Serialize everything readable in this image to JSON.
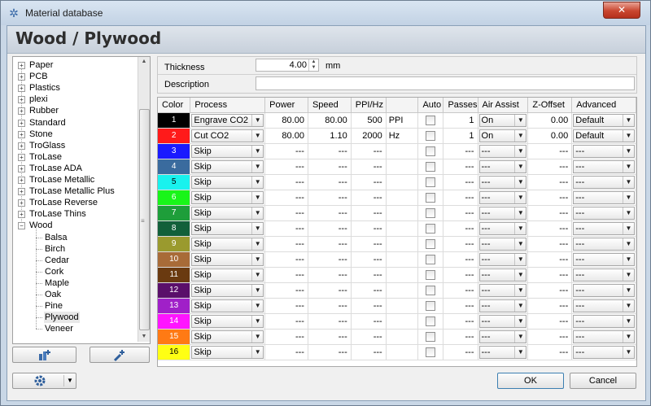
{
  "window": {
    "title": "Material database",
    "close_glyph": "✕"
  },
  "header": {
    "title": "Wood / Plywood"
  },
  "tree": {
    "items": [
      {
        "label": "Paper",
        "expander": "+"
      },
      {
        "label": "PCB",
        "expander": "+"
      },
      {
        "label": "Plastics",
        "expander": "+"
      },
      {
        "label": "plexi",
        "expander": "+"
      },
      {
        "label": "Rubber",
        "expander": "+"
      },
      {
        "label": "Standard",
        "expander": "+"
      },
      {
        "label": "Stone",
        "expander": "+"
      },
      {
        "label": "TroGlass",
        "expander": "+"
      },
      {
        "label": "TroLase",
        "expander": "+"
      },
      {
        "label": "TroLase ADA",
        "expander": "+"
      },
      {
        "label": "TroLase Metallic",
        "expander": "+"
      },
      {
        "label": "TroLase Metallic Plus",
        "expander": "+"
      },
      {
        "label": "TroLase Reverse",
        "expander": "+"
      },
      {
        "label": "TroLase Thins",
        "expander": "+"
      },
      {
        "label": "Wood",
        "expander": "−"
      }
    ],
    "children": [
      "Balsa",
      "Birch",
      "Cedar",
      "Cork",
      "Maple",
      "Oak",
      "Pine",
      "Plywood",
      "Veneer"
    ],
    "selected_child": "Plywood"
  },
  "properties": {
    "thickness_label": "Thickness",
    "thickness_value": "4.00",
    "thickness_unit": "mm",
    "description_label": "Description",
    "description_value": ""
  },
  "grid": {
    "headers": [
      "Color",
      "Process",
      "Power",
      "Speed",
      "PPI/Hz",
      "",
      "Auto",
      "Passes",
      "Air Assist",
      "Z-Offset",
      "Advanced"
    ],
    "rows": [
      {
        "n": "1",
        "color": "#000000",
        "fg": "#ffffff",
        "process": "Engrave CO2",
        "power": "80.00",
        "speed": "80.00",
        "ppi": "500",
        "unit": "PPI",
        "passes": "1",
        "air": "On",
        "z": "0.00",
        "adv": "Default"
      },
      {
        "n": "2",
        "color": "#ff1a1a",
        "fg": "#ffffff",
        "process": "Cut CO2",
        "power": "80.00",
        "speed": "1.10",
        "ppi": "2000",
        "unit": "Hz",
        "passes": "1",
        "air": "On",
        "z": "0.00",
        "adv": "Default"
      },
      {
        "n": "3",
        "color": "#1a1aff",
        "fg": "#ffffff",
        "process": "Skip",
        "power": "---",
        "speed": "---",
        "ppi": "---",
        "unit": "",
        "passes": "---",
        "air": "---",
        "z": "---",
        "adv": "---"
      },
      {
        "n": "4",
        "color": "#3a6b9e",
        "fg": "#ffffff",
        "process": "Skip",
        "power": "---",
        "speed": "---",
        "ppi": "---",
        "unit": "",
        "passes": "---",
        "air": "---",
        "z": "---",
        "adv": "---"
      },
      {
        "n": "5",
        "color": "#19f2ee",
        "fg": "#000000",
        "process": "Skip",
        "power": "---",
        "speed": "---",
        "ppi": "---",
        "unit": "",
        "passes": "---",
        "air": "---",
        "z": "---",
        "adv": "---"
      },
      {
        "n": "6",
        "color": "#19f519",
        "fg": "#ffffff",
        "process": "Skip",
        "power": "---",
        "speed": "---",
        "ppi": "---",
        "unit": "",
        "passes": "---",
        "air": "---",
        "z": "---",
        "adv": "---"
      },
      {
        "n": "7",
        "color": "#1e9e3a",
        "fg": "#ffffff",
        "process": "Skip",
        "power": "---",
        "speed": "---",
        "ppi": "---",
        "unit": "",
        "passes": "---",
        "air": "---",
        "z": "---",
        "adv": "---"
      },
      {
        "n": "8",
        "color": "#12603a",
        "fg": "#ffffff",
        "process": "Skip",
        "power": "---",
        "speed": "---",
        "ppi": "---",
        "unit": "",
        "passes": "---",
        "air": "---",
        "z": "---",
        "adv": "---"
      },
      {
        "n": "9",
        "color": "#9a9a2e",
        "fg": "#ffffff",
        "process": "Skip",
        "power": "---",
        "speed": "---",
        "ppi": "---",
        "unit": "",
        "passes": "---",
        "air": "---",
        "z": "---",
        "adv": "---"
      },
      {
        "n": "10",
        "color": "#a86b38",
        "fg": "#ffffff",
        "process": "Skip",
        "power": "---",
        "speed": "---",
        "ppi": "---",
        "unit": "",
        "passes": "---",
        "air": "---",
        "z": "---",
        "adv": "---"
      },
      {
        "n": "11",
        "color": "#6a3a10",
        "fg": "#ffffff",
        "process": "Skip",
        "power": "---",
        "speed": "---",
        "ppi": "---",
        "unit": "",
        "passes": "---",
        "air": "---",
        "z": "---",
        "adv": "---"
      },
      {
        "n": "12",
        "color": "#5a0f6a",
        "fg": "#ffffff",
        "process": "Skip",
        "power": "---",
        "speed": "---",
        "ppi": "---",
        "unit": "",
        "passes": "---",
        "air": "---",
        "z": "---",
        "adv": "---"
      },
      {
        "n": "13",
        "color": "#a020c8",
        "fg": "#ffffff",
        "process": "Skip",
        "power": "---",
        "speed": "---",
        "ppi": "---",
        "unit": "",
        "passes": "---",
        "air": "---",
        "z": "---",
        "adv": "---"
      },
      {
        "n": "14",
        "color": "#ff14ff",
        "fg": "#ffffff",
        "process": "Skip",
        "power": "---",
        "speed": "---",
        "ppi": "---",
        "unit": "",
        "passes": "---",
        "air": "---",
        "z": "---",
        "adv": "---"
      },
      {
        "n": "15",
        "color": "#ff7a14",
        "fg": "#ffffff",
        "process": "Skip",
        "power": "---",
        "speed": "---",
        "ppi": "---",
        "unit": "",
        "passes": "---",
        "air": "---",
        "z": "---",
        "adv": "---"
      },
      {
        "n": "16",
        "color": "#ffff14",
        "fg": "#000000",
        "process": "Skip",
        "power": "---",
        "speed": "---",
        "ppi": "---",
        "unit": "",
        "passes": "---",
        "air": "---",
        "z": "---",
        "adv": "---"
      }
    ]
  },
  "buttons": {
    "ok": "OK",
    "cancel": "Cancel",
    "add_material_icon": "add-material-icon",
    "add_process_icon": "add-process-icon",
    "settings_icon": "gear-icon"
  },
  "colors": {
    "accent": "#c9d7e6",
    "close": "#c9462f"
  }
}
